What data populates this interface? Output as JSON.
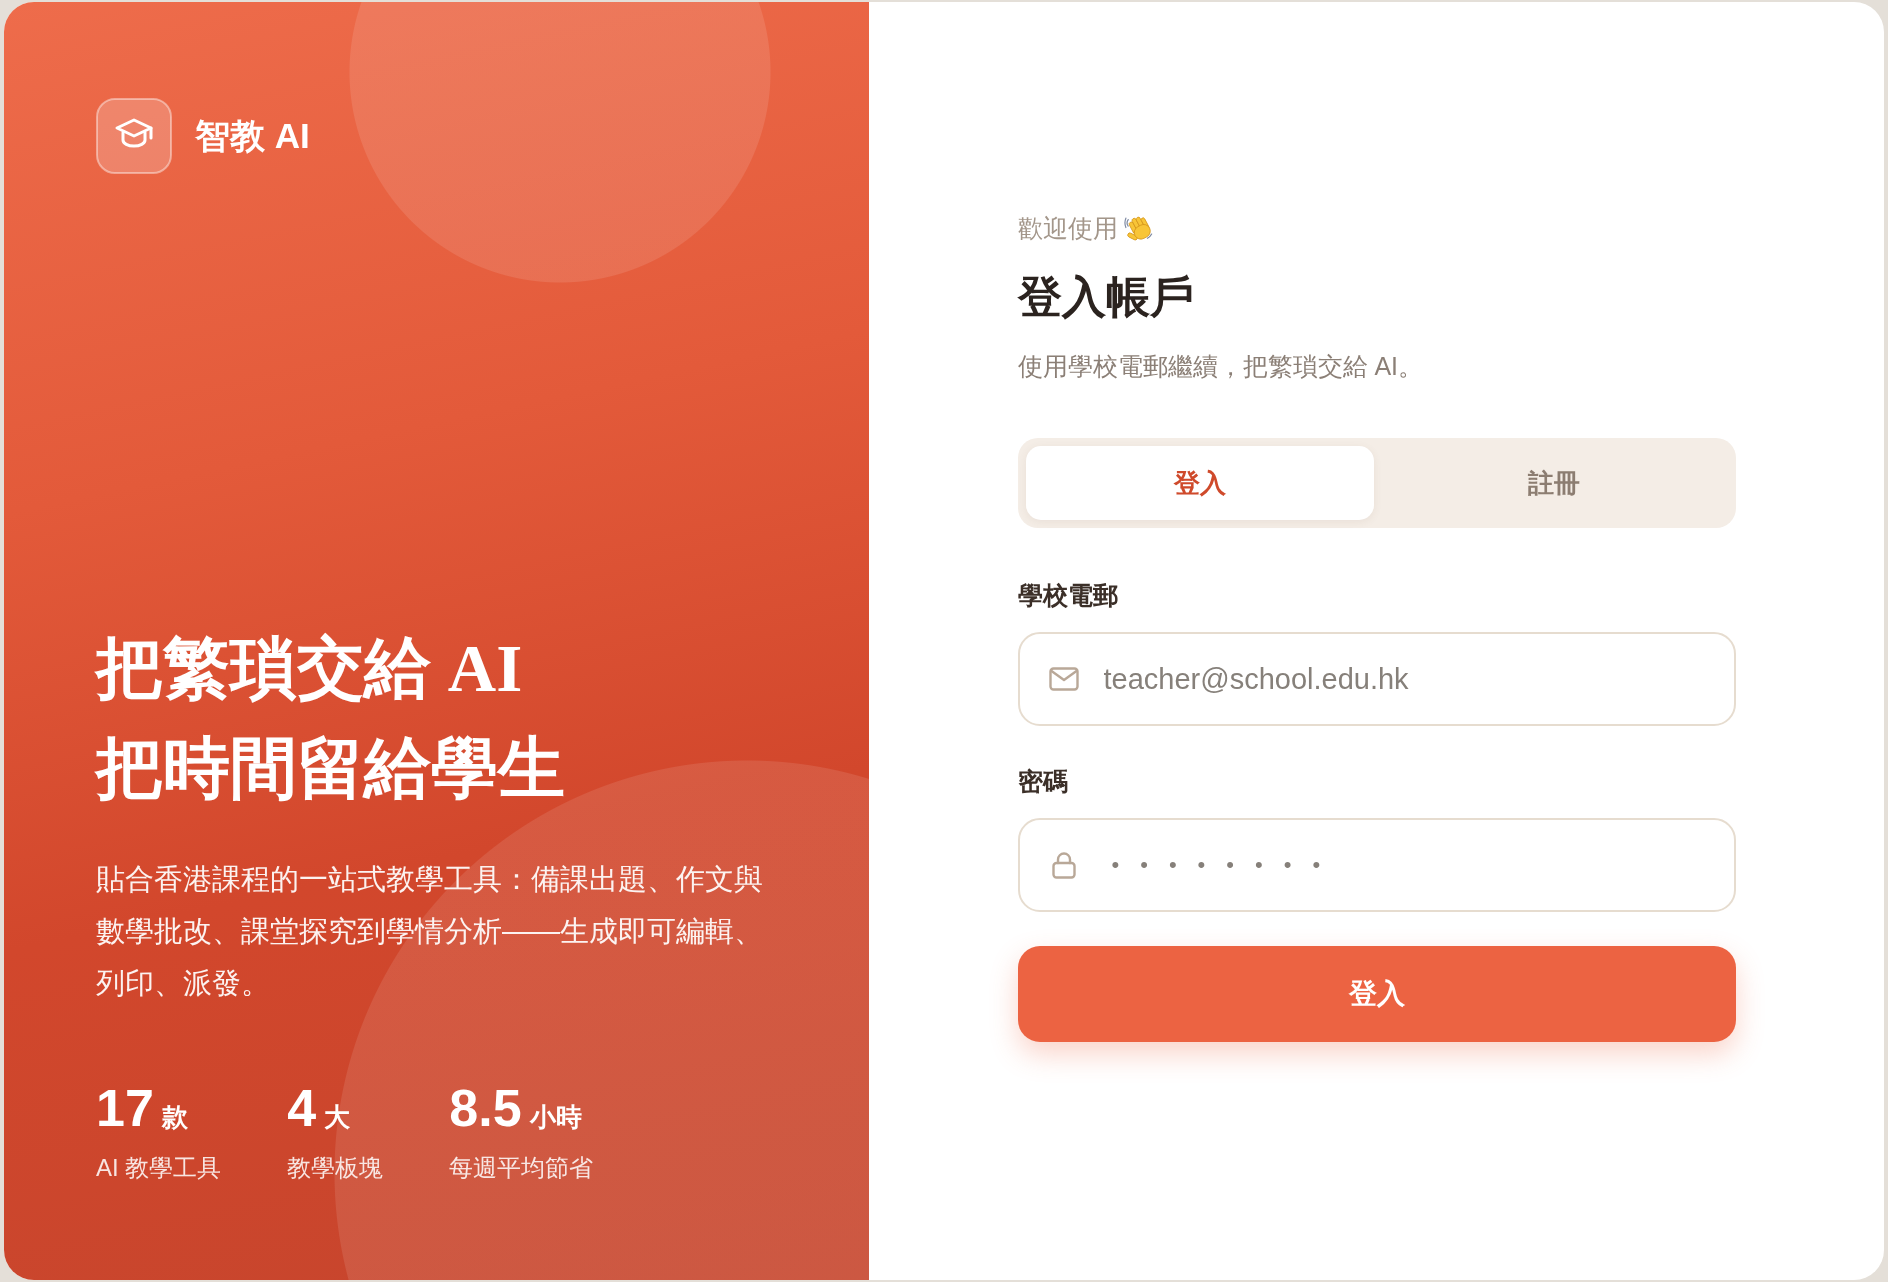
{
  "brand": {
    "name": "智教 AI"
  },
  "hero": {
    "headline": [
      "把繁瑣交給 AI",
      "把時間留給學生"
    ],
    "description": "貼合香港課程的一站式教學工具：備課出題、作文與數學批改、課堂探究到學情分析——生成即可編輯、列印、派發。",
    "stats": [
      {
        "value": "17",
        "unit": "款",
        "label": "AI 教學工具"
      },
      {
        "value": "4",
        "unit": "大",
        "label": "教學板塊"
      },
      {
        "value": "8.5",
        "unit": "小時",
        "label": "每週平均節省"
      }
    ]
  },
  "login": {
    "greeting": "歡迎使用",
    "title": "登入帳戶",
    "subtitle": "使用學校電郵繼續，把繁瑣交給 AI。",
    "tabs": [
      {
        "label": "登入",
        "selected": true
      },
      {
        "label": "註冊",
        "selected": false
      }
    ],
    "fields": [
      {
        "kind": "email",
        "label": "學校電郵",
        "placeholder": "teacher@school.edu.hk"
      },
      {
        "kind": "password",
        "label": "密碼",
        "placeholder": "••••••••"
      }
    ],
    "submit": {
      "label": "登入"
    }
  }
}
